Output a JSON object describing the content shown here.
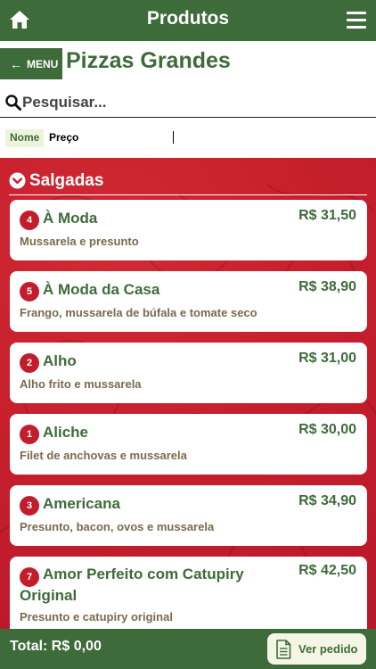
{
  "header": {
    "title": "Produtos",
    "home_icon": "home-icon",
    "menu_icon": "hamburger-menu-icon"
  },
  "nav": {
    "back_label": "MENU",
    "page_title": "Pizzas Grandes"
  },
  "search": {
    "placeholder": "Pesquisar..."
  },
  "sort": {
    "name_label": "Nome",
    "price_label": "Preço"
  },
  "section": {
    "title": "Salgadas"
  },
  "products": [
    {
      "number": "4",
      "name": "À Moda",
      "price": "R$ 31,50",
      "description": "Mussarela e presunto"
    },
    {
      "number": "5",
      "name": "À Moda da Casa",
      "price": "R$ 38,90",
      "description": "Frango, mussarela de búfala e tomate seco"
    },
    {
      "number": "2",
      "name": "Alho",
      "price": "R$ 31,00",
      "description": "Alho frito e mussarela"
    },
    {
      "number": "1",
      "name": "Aliche",
      "price": "R$ 30,00",
      "description": "Filet de anchovas e mussarela"
    },
    {
      "number": "3",
      "name": "Americana",
      "price": "R$ 34,90",
      "description": "Presunto, bacon, ovos e mussarela"
    },
    {
      "number": "7",
      "name": "Amor Perfeito com Catupiry Original",
      "price": "R$ 42,50",
      "description": "Presunto e catupiry original"
    }
  ],
  "footer": {
    "total": "Total: R$ 0,00",
    "order_button": "Ver pedido"
  },
  "colors": {
    "primary_green": "#3e6b3a",
    "accent_red": "#c8202c",
    "description_brown": "#7a6a4e"
  }
}
